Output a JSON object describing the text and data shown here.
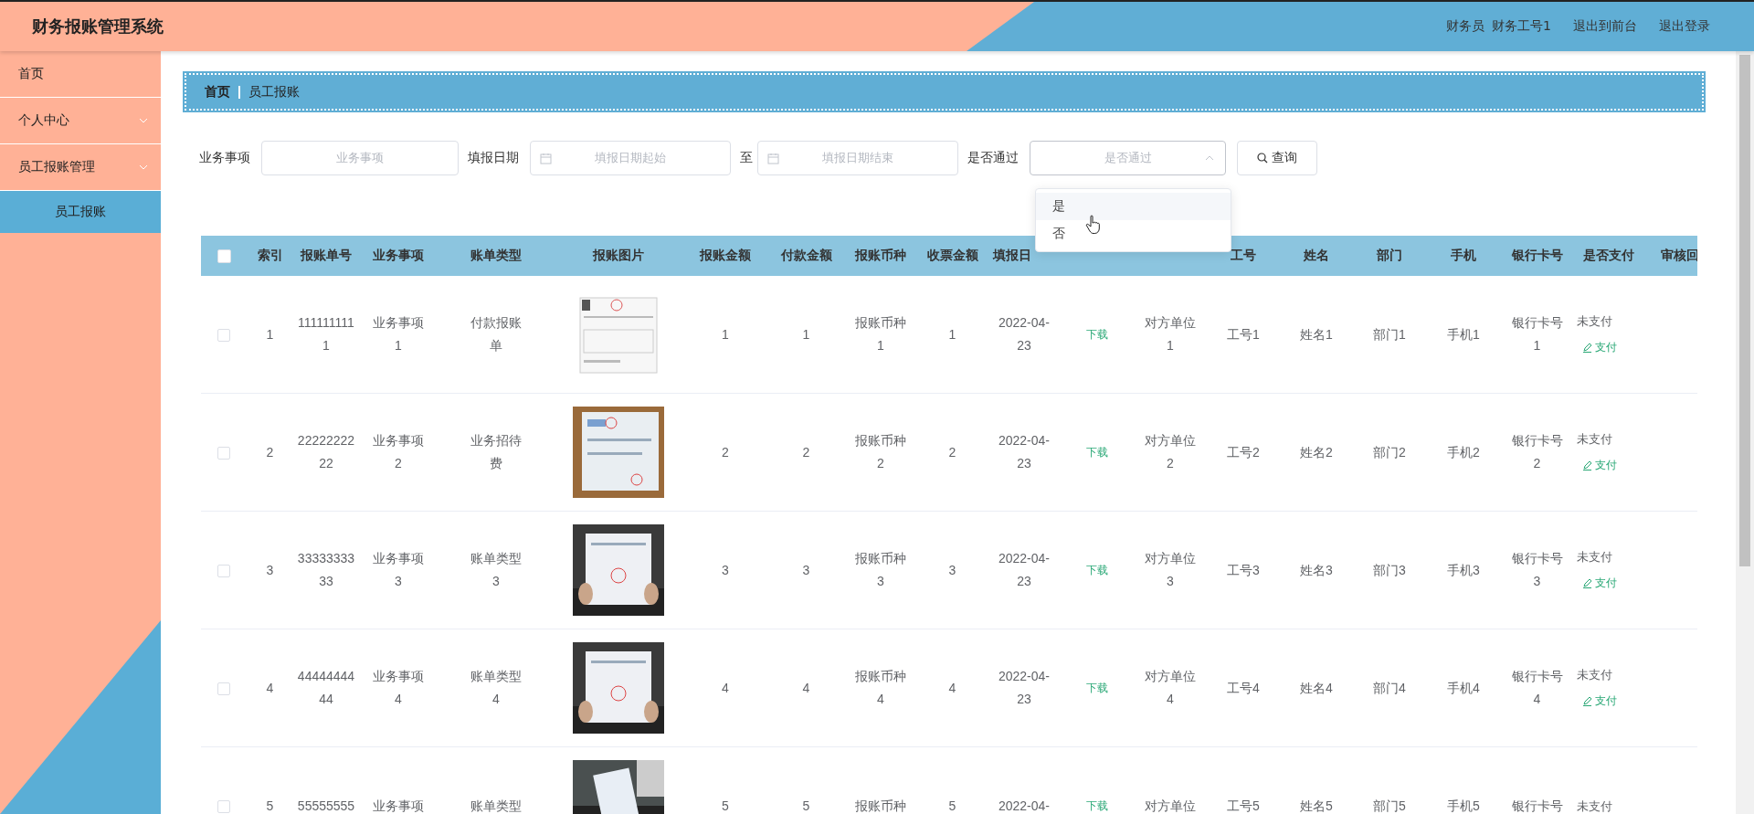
{
  "app_title": "财务报账管理系统",
  "user": {
    "role": "财务员",
    "name": "财务工号1"
  },
  "header_links": [
    "退出到前台",
    "退出登录"
  ],
  "sidebar": {
    "items": [
      {
        "label": "首页",
        "has_submenu": false,
        "selected": false
      },
      {
        "label": "个人中心",
        "has_submenu": true,
        "selected": false
      },
      {
        "label": "员工报账管理",
        "has_submenu": true,
        "selected": false,
        "children": [
          {
            "label": "员工报账",
            "selected": true
          }
        ]
      }
    ]
  },
  "breadcrumb": [
    {
      "label": "首页",
      "current": false
    },
    {
      "label": "员工报账",
      "current": true
    }
  ],
  "filters": [
    {
      "kind": "text",
      "label": "业务事项",
      "placeholder": "业务事项"
    },
    {
      "kind": "daterange",
      "label": "填报日期",
      "start_placeholder": "填报日期起始",
      "separator": "至",
      "end_placeholder": "填报日期结束"
    },
    {
      "kind": "select",
      "label": "是否通过",
      "placeholder": "是否通过",
      "open": true,
      "options": [
        {
          "label": "是",
          "highlighted": true
        },
        {
          "label": "否",
          "highlighted": false
        }
      ]
    }
  ],
  "search_button": "查询",
  "table": {
    "all_selected": false,
    "columns": [
      {
        "kind": "checkbox"
      },
      {
        "label": "索引"
      },
      {
        "label": "报账单号"
      },
      {
        "label": "业务事项"
      },
      {
        "label": "账单类型"
      },
      {
        "label": "报账图片"
      },
      {
        "label": "报账金额"
      },
      {
        "label": "付款金额"
      },
      {
        "label": "报账币种"
      },
      {
        "label": "收票金额"
      },
      {
        "label": "填报日"
      },
      {
        "kind": "covered"
      },
      {
        "kind": "covered"
      },
      {
        "label": "工号"
      },
      {
        "label": "姓名"
      },
      {
        "label": "部门"
      },
      {
        "label": "手机"
      },
      {
        "label": "银行卡号"
      },
      {
        "label": "是否支付"
      },
      {
        "label": "审核回"
      }
    ],
    "rows": [
      {
        "selected": false,
        "index": "1",
        "number": "1111111111",
        "item": "业务事项1",
        "bill_type": "付款报账单",
        "amount": "1",
        "paid": "1",
        "currency": "报账币种1",
        "receipt": "1",
        "date": "2022-04-23",
        "attachment": "下载",
        "counterparty": "对方单位1",
        "staff_no": "工号1",
        "name": "姓名1",
        "dept": "部门1",
        "phone": "手机1",
        "bank_card": "银行卡号1",
        "pay_status": "未支付",
        "pay_action": "支付"
      },
      {
        "selected": false,
        "index": "2",
        "number": "2222222222",
        "item": "业务事项2",
        "bill_type": "业务招待费",
        "amount": "2",
        "paid": "2",
        "currency": "报账币种2",
        "receipt": "2",
        "date": "2022-04-23",
        "attachment": "下载",
        "counterparty": "对方单位2",
        "staff_no": "工号2",
        "name": "姓名2",
        "dept": "部门2",
        "phone": "手机2",
        "bank_card": "银行卡号2",
        "pay_status": "未支付",
        "pay_action": "支付"
      },
      {
        "selected": false,
        "index": "3",
        "number": "3333333333",
        "item": "业务事项3",
        "bill_type": "账单类型3",
        "amount": "3",
        "paid": "3",
        "currency": "报账币种3",
        "receipt": "3",
        "date": "2022-04-23",
        "attachment": "下载",
        "counterparty": "对方单位3",
        "staff_no": "工号3",
        "name": "姓名3",
        "dept": "部门3",
        "phone": "手机3",
        "bank_card": "银行卡号3",
        "pay_status": "未支付",
        "pay_action": "支付"
      },
      {
        "selected": false,
        "index": "4",
        "number": "4444444444",
        "item": "业务事项4",
        "bill_type": "账单类型4",
        "amount": "4",
        "paid": "4",
        "currency": "报账币种4",
        "receipt": "4",
        "date": "2022-04-23",
        "attachment": "下载",
        "counterparty": "对方单位4",
        "staff_no": "工号4",
        "name": "姓名4",
        "dept": "部门4",
        "phone": "手机4",
        "bank_card": "银行卡号4",
        "pay_status": "未支付",
        "pay_action": "支付"
      },
      {
        "selected": false,
        "index": "5",
        "number": "55555555",
        "item": "业务事项",
        "bill_type": "账单类型",
        "amount": "5",
        "paid": "5",
        "currency": "报账币种",
        "receipt": "5",
        "date": "2022-04-",
        "attachment": "下载",
        "counterparty": "对方单位",
        "staff_no": "工号5",
        "name": "姓名5",
        "dept": "部门5",
        "phone": "手机5",
        "bank_card": "银行卡号",
        "pay_status": "未支付"
      }
    ]
  }
}
